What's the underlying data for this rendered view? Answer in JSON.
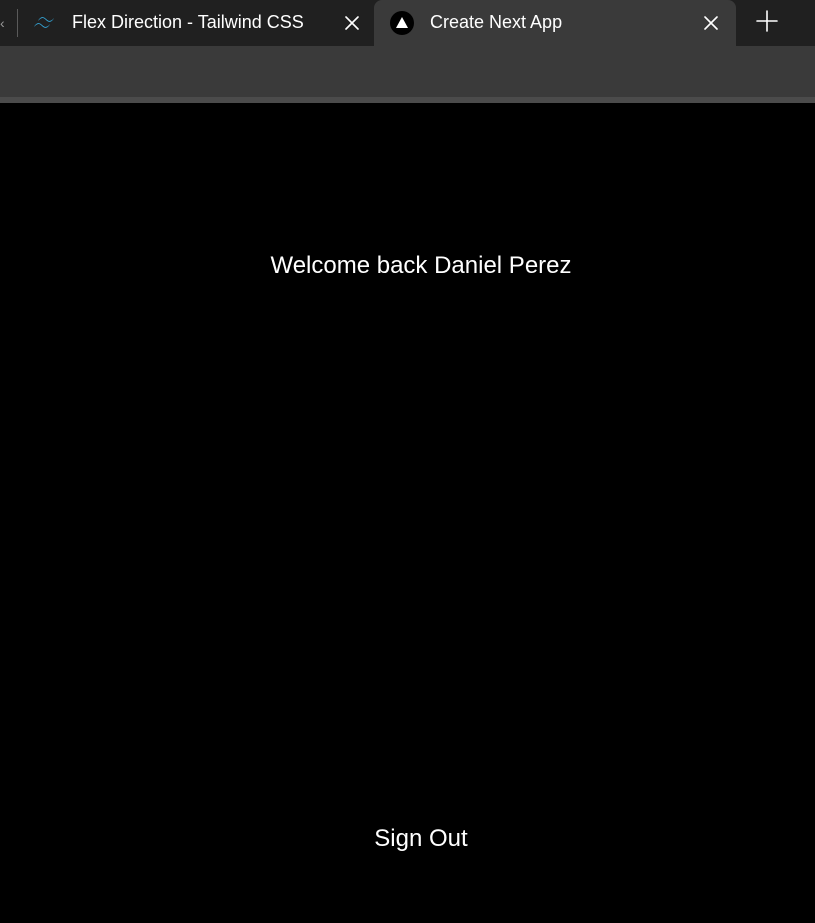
{
  "browser": {
    "tabs": [
      {
        "title": "Flex Direction - Tailwind CSS",
        "favicon": "tailwind-logo-icon",
        "active": false,
        "close_icon": "close-icon"
      },
      {
        "title": "Create Next App",
        "favicon": "next-triangle-icon",
        "active": true,
        "close_icon": "close-icon"
      }
    ],
    "new_tab_icon": "plus-icon",
    "colors": {
      "tabstrip": "#202020",
      "active_tab": "#3a3a3a",
      "toolbar": "#3a3a3a",
      "tailwind_accent": "#38bdf8"
    }
  },
  "page": {
    "welcome_text": "Welcome back Daniel Perez",
    "sign_out_label": "Sign Out",
    "background_color": "#000000",
    "text_color": "#ffffff"
  }
}
